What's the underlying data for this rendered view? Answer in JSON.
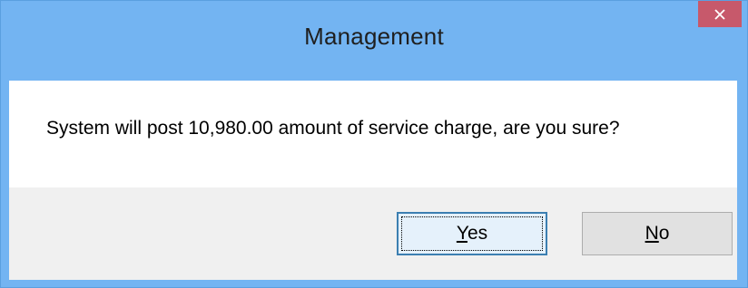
{
  "window": {
    "title": "Management",
    "close_icon": "close-icon"
  },
  "message": {
    "text": "System will post 10,980.00 amount of service charge, are you sure?"
  },
  "buttons": {
    "yes": {
      "mnemonic": "Y",
      "rest": "es",
      "default": true
    },
    "no": {
      "mnemonic": "N",
      "rest": "o",
      "default": false
    }
  },
  "colors": {
    "titlebar": "#73b4f2",
    "close_button": "#c7596b",
    "footer": "#f0f0f0",
    "default_button_border": "#3c7fb1"
  }
}
